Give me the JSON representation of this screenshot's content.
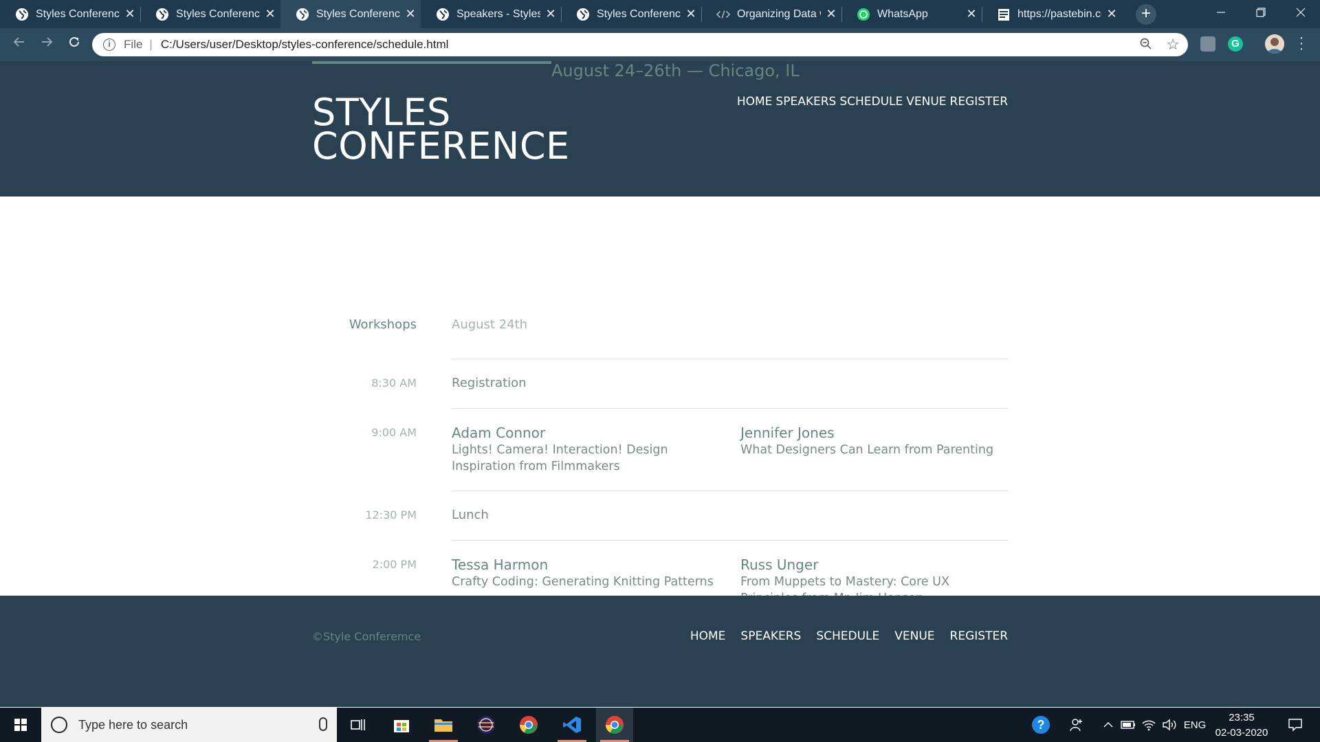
{
  "browser": {
    "tabs": [
      {
        "title": "Styles Conference",
        "icon": "globe-icon",
        "active": false
      },
      {
        "title": "Styles Conference",
        "icon": "globe-icon",
        "active": false
      },
      {
        "title": "Styles Conference",
        "icon": "globe-icon",
        "active": true
      },
      {
        "title": "Speakers - Styles C",
        "icon": "globe-icon",
        "active": false
      },
      {
        "title": "Styles Conference",
        "icon": "globe-icon",
        "active": false
      },
      {
        "title": "Organizing Data w",
        "icon": "code-icon",
        "active": false
      },
      {
        "title": "WhatsApp",
        "icon": "whatsapp-icon",
        "active": false
      },
      {
        "title": "https://pastebin.cc",
        "icon": "pastebin-icon",
        "active": false
      }
    ],
    "close_glyph": "✕",
    "new_tab_glyph": "+",
    "address": {
      "scheme": "File",
      "url": "C:/Users/user/Desktop/styles-conference/schedule.html"
    }
  },
  "site": {
    "tagline": "August 24–26th — Chicago, IL",
    "logo_line1": "STYLES",
    "logo_line2": "CONFERENCE",
    "nav": [
      "HOME",
      "SPEAKERS",
      "SCHEDULE",
      "VENUE",
      "REGISTER"
    ],
    "colors": {
      "header_bg": "#2a4152",
      "accent": "#648880",
      "muted": "#a3b3ae"
    }
  },
  "schedule": {
    "label": "Workshops",
    "day": "August 24th",
    "slots": [
      {
        "time": "8:30 AM",
        "single": "Registration"
      },
      {
        "time": "9:00 AM",
        "talks": [
          {
            "speaker": "Adam Connor",
            "title": "Lights! Camera! Interaction! Design Inspiration from Filmmakers"
          },
          {
            "speaker": "Jennifer Jones",
            "title": "What Designers Can Learn from Parenting"
          }
        ]
      },
      {
        "time": "12:30 PM",
        "single": "Lunch"
      },
      {
        "time": "2:00 PM",
        "talks": [
          {
            "speaker": "Tessa Harmon",
            "title": "Crafty Coding: Generating Knitting Patterns"
          },
          {
            "speaker": "Russ Unger",
            "title": "From Muppets to Mastery: Core UX Principles from Mr. Jim Henson"
          }
        ]
      }
    ]
  },
  "footer": {
    "copyright": "©Style Conferemce",
    "nav": [
      "HOME",
      "SPEAKERS",
      "SCHEDULE",
      "VENUE",
      "REGISTER"
    ]
  },
  "taskbar": {
    "search_placeholder": "Type here to search",
    "language": "ENG",
    "time": "23:35",
    "date": "02-03-2020"
  }
}
